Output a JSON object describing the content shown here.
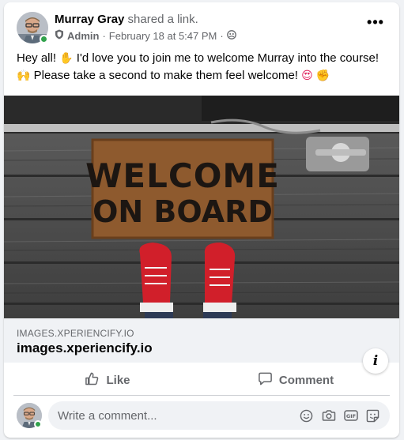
{
  "post": {
    "author_name": "Murray Gray",
    "action_text": " shared a link.",
    "role": "Admin",
    "separator": "·",
    "timestamp": "February 18 at 5:47 PM",
    "audience_separator": "·",
    "more_label": "•••",
    "text_part1": "Hey all! ",
    "text_part2": " I'd love you to join me to welcome Murray into the course! ",
    "text_part3": " Please take a second to make them feel welcome! ",
    "image_caption": {
      "line1": "WELCOME",
      "line2": "ON BOARD"
    }
  },
  "link": {
    "domain": "IMAGES.XPERIENCIFY.IO",
    "title": "images.xperiencify.io",
    "info_label": "i"
  },
  "actions": {
    "like_label": "Like",
    "comment_label": "Comment"
  },
  "comment": {
    "placeholder": "Write a comment..."
  },
  "colors": {
    "online": "#31a24c",
    "secondary_text": "#65676b",
    "surface": "#f0f2f5"
  },
  "icons": {
    "admin": "shield-icon",
    "audience": "group-icon",
    "more": "more-options-icon",
    "like": "thumbs-up-icon",
    "comment": "speech-bubble-icon",
    "emoji": "smiley-icon",
    "camera": "camera-icon",
    "gif": "gif-icon",
    "sticker": "sticker-icon",
    "info": "info-icon"
  }
}
